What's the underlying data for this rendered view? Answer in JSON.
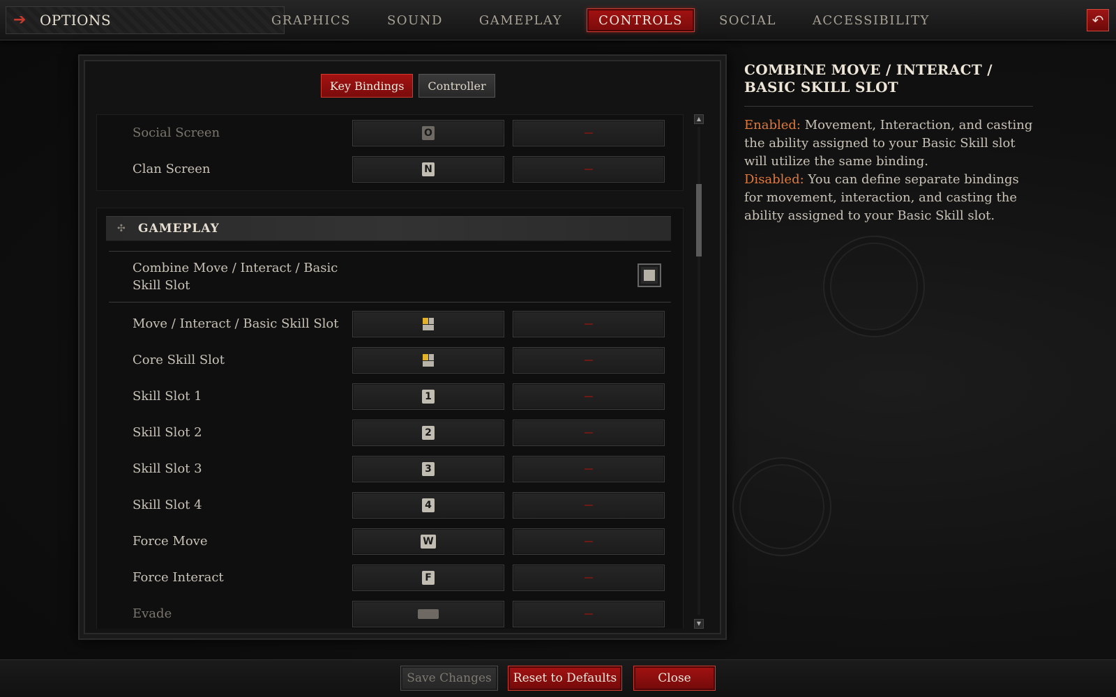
{
  "topbar": {
    "title": "OPTIONS",
    "tabs": [
      {
        "label": "GRAPHICS",
        "active": false
      },
      {
        "label": "SOUND",
        "active": false
      },
      {
        "label": "GAMEPLAY",
        "active": false
      },
      {
        "label": "CONTROLS",
        "active": true
      },
      {
        "label": "SOCIAL",
        "active": false
      },
      {
        "label": "ACCESSIBILITY",
        "active": false
      }
    ],
    "back_icon": "back-arrow-icon"
  },
  "subtabs": [
    {
      "label": "Key Bindings",
      "active": true
    },
    {
      "label": "Controller",
      "active": false
    }
  ],
  "bindings_top": [
    {
      "label": "Social Screen",
      "primary": "O",
      "secondary": "",
      "dim": true
    },
    {
      "label": "Clan Screen",
      "primary": "N",
      "secondary": ""
    }
  ],
  "gameplay_section": {
    "title": "GAMEPLAY",
    "combine_toggle": {
      "label": "Combine Move / Interact / Basic Skill Slot",
      "checked": true
    },
    "bindings": [
      {
        "label": "Move / Interact / Basic Skill Slot",
        "primary": "mouse-left-icon",
        "secondary": ""
      },
      {
        "label": "Core Skill Slot",
        "primary": "mouse-left-icon",
        "secondary": ""
      },
      {
        "label": "Skill Slot 1",
        "primary": "1",
        "secondary": ""
      },
      {
        "label": "Skill Slot 2",
        "primary": "2",
        "secondary": ""
      },
      {
        "label": "Skill Slot 3",
        "primary": "3",
        "secondary": ""
      },
      {
        "label": "Skill Slot 4",
        "primary": "4",
        "secondary": ""
      },
      {
        "label": "Force Move",
        "primary": "W",
        "secondary": ""
      },
      {
        "label": "Force Interact",
        "primary": "F",
        "secondary": ""
      },
      {
        "label": "Evade",
        "primary": "spacebar-icon",
        "secondary": "",
        "dim": true
      }
    ]
  },
  "info": {
    "title": "COMBINE MOVE / INTERACT / BASIC SKILL SLOT",
    "enabled_label": "Enabled:",
    "enabled_text": " Movement, Interaction, and casting the ability assigned to your Basic Skill slot will utilize the same binding.",
    "disabled_label": "Disabled:",
    "disabled_text": " You can define separate bindings for movement, interaction, and casting the ability assigned to your Basic Skill slot."
  },
  "footer": {
    "save": "Save Changes",
    "reset": "Reset to Defaults",
    "close": "Close"
  },
  "colors": {
    "accent_red": "#a31212",
    "highlight_orange": "#e07a3c"
  }
}
